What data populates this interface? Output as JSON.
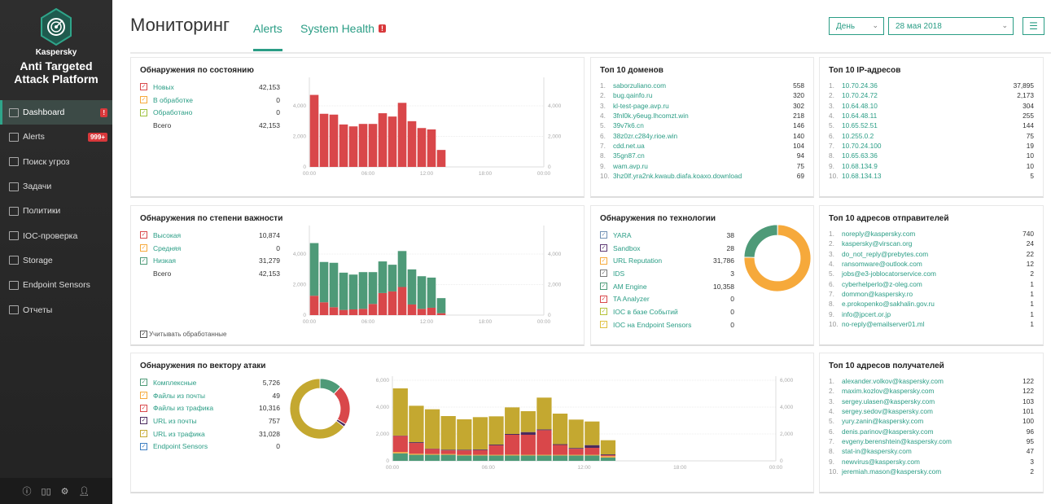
{
  "sidebar": {
    "brand_small": "Kaspersky",
    "brand_line1": "Anti Targeted",
    "brand_line2": "Attack Platform",
    "items": [
      {
        "label": "Dashboard",
        "badge": "!",
        "icon": "dashboard-icon"
      },
      {
        "label": "Alerts",
        "badge": "999+",
        "icon": "flag-icon"
      },
      {
        "label": "Поиск угроз",
        "icon": "threat-search-icon"
      },
      {
        "label": "Задачи",
        "icon": "tasks-icon"
      },
      {
        "label": "Политики",
        "icon": "policies-icon"
      },
      {
        "label": "IOC-проверка",
        "icon": "key-search-icon"
      },
      {
        "label": "Storage",
        "icon": "storage-icon"
      },
      {
        "label": "Endpoint Sensors",
        "icon": "monitor-icon"
      },
      {
        "label": "Отчеты",
        "icon": "report-icon"
      }
    ],
    "bottom_icons": [
      "info-icon",
      "book-icon",
      "gear-icon",
      "user-icon"
    ]
  },
  "header": {
    "title": "Мониторинг",
    "tabs": [
      {
        "label": "Alerts",
        "active": true
      },
      {
        "label": "System Health",
        "badge": "!"
      }
    ],
    "period": "День",
    "date": "28 мая 2018",
    "menu_icon": "hamburger-icon"
  },
  "colors": {
    "accent": "#2a9d85",
    "red": "#d9474a",
    "orange": "#f6a93b",
    "yellowgreen": "#9bbf3a",
    "green": "#4e9a78",
    "purple": "#4a2a5e",
    "olive": "#c4a830",
    "blue": "#3d7fc2"
  },
  "state": {
    "title": "Обнаружения по состоянию",
    "legend": [
      {
        "label": "Новых",
        "value": "42,153",
        "color": "#d9474a"
      },
      {
        "label": "В обработке",
        "value": "0",
        "color": "#f6a93b"
      },
      {
        "label": "Обработано",
        "value": "0",
        "color": "#9bbf3a"
      }
    ],
    "total_label": "Всего",
    "total": "42,153"
  },
  "severity": {
    "title": "Обнаружения по степени важности",
    "legend": [
      {
        "label": "Высокая",
        "value": "10,874",
        "color": "#d9474a"
      },
      {
        "label": "Средняя",
        "value": "0",
        "color": "#f6a93b"
      },
      {
        "label": "Низкая",
        "value": "31,279",
        "color": "#4e9a78"
      }
    ],
    "total_label": "Всего",
    "total": "42,153",
    "include_processed": "Учитывать обработанные"
  },
  "vector": {
    "title": "Обнаружения по вектору атаки",
    "legend": [
      {
        "label": "Комплексные",
        "value": "5,726",
        "color": "#4e9a78"
      },
      {
        "label": "Файлы из почты",
        "value": "49",
        "color": "#f6a93b"
      },
      {
        "label": "Файлы из трафика",
        "value": "10,316",
        "color": "#d9474a"
      },
      {
        "label": "URL из почты",
        "value": "757",
        "color": "#4a2a5e"
      },
      {
        "label": "URL из трафика",
        "value": "31,028",
        "color": "#c4a830"
      },
      {
        "label": "Endpoint Sensors",
        "value": "0",
        "color": "#3d7fc2"
      }
    ]
  },
  "technology": {
    "title": "Обнаружения по технологии",
    "legend": [
      {
        "label": "YARA",
        "value": "38",
        "color": "#6f8fb3"
      },
      {
        "label": "Sandbox",
        "value": "28",
        "color": "#5e3a74"
      },
      {
        "label": "URL Reputation",
        "value": "31,786",
        "color": "#f6a93b"
      },
      {
        "label": "IDS",
        "value": "3",
        "color": "#777777"
      },
      {
        "label": "AM Engine",
        "value": "10,358",
        "color": "#4e9a78"
      },
      {
        "label": "TA Analyzer",
        "value": "0",
        "color": "#d9474a"
      },
      {
        "label": "IOC в базе Событий",
        "value": "0",
        "color": "#b5c23a"
      },
      {
        "label": "IOC на Endpoint Sensors",
        "value": "0",
        "color": "#e0c040"
      }
    ]
  },
  "top_domains": {
    "title": "Топ 10 доменов",
    "items": [
      [
        "saborzuliano.com",
        "558"
      ],
      [
        "bug.qainfo.ru",
        "320"
      ],
      [
        "kl-test-page.avp.ru",
        "302"
      ],
      [
        "3fnl0k.y6eug.lhcomzt.win",
        "218"
      ],
      [
        "39v7k6.cn",
        "146"
      ],
      [
        "38z0zr.c284y.rioe.win",
        "140"
      ],
      [
        "cdd.net.ua",
        "104"
      ],
      [
        "35gn87.cn",
        "94"
      ],
      [
        "wam.avp.ru",
        "75"
      ],
      [
        "3hz0lf.yra2nk.kwaub.diafa.koaxo.download",
        "69"
      ]
    ]
  },
  "top_ips": {
    "title": "Топ 10 IP-адресов",
    "items": [
      [
        "10.70.24.36",
        "37,895"
      ],
      [
        "10.70.24.72",
        "2,173"
      ],
      [
        "10.64.48.10",
        "304"
      ],
      [
        "10.64.48.11",
        "255"
      ],
      [
        "10.65.52.51",
        "144"
      ],
      [
        "10.255.0.2",
        "75"
      ],
      [
        "10.70.24.100",
        "19"
      ],
      [
        "10.65.63.36",
        "10"
      ],
      [
        "10.68.134.9",
        "10"
      ],
      [
        "10.68.134.13",
        "5"
      ]
    ]
  },
  "top_senders": {
    "title": "Топ 10 адресов отправителей",
    "items": [
      [
        "noreply@kaspersky.com",
        "740"
      ],
      [
        "kaspersky@virscan.org",
        "24"
      ],
      [
        "do_not_reply@prebytes.com",
        "22"
      ],
      [
        "ransomware@outlook.com",
        "12"
      ],
      [
        "jobs@e3-joblocatorservice.com",
        "2"
      ],
      [
        "cyberhelperlo@z-oleg.com",
        "1"
      ],
      [
        "dommon@kaspersky.ro",
        "1"
      ],
      [
        "e.prokopenko@sakhalin.gov.ru",
        "1"
      ],
      [
        "info@jpcert.or.jp",
        "1"
      ],
      [
        "no-reply@emailserver01.ml",
        "1"
      ]
    ]
  },
  "top_recipients": {
    "title": "Топ 10 адресов получателей",
    "items": [
      [
        "alexander.volkov@kaspersky.com",
        "122"
      ],
      [
        "maxim.kozlov@kaspersky.com",
        "122"
      ],
      [
        "sergey.ulasen@kaspersky.com",
        "103"
      ],
      [
        "sergey.sedov@kaspersky.com",
        "101"
      ],
      [
        "yury.zanin@kaspersky.com",
        "100"
      ],
      [
        "denis.parinov@kaspersky.com",
        "96"
      ],
      [
        "evgeny.berenshtein@kaspersky.com",
        "95"
      ],
      [
        "stat-in@kaspersky.com",
        "47"
      ],
      [
        "newvirus@kaspersky.com",
        "3"
      ],
      [
        "jeremiah.mason@kaspersky.com",
        "2"
      ]
    ]
  },
  "chart_data": [
    {
      "id": "state",
      "type": "bar",
      "stacked": true,
      "x_ticks": [
        "00:00",
        "06:00",
        "12:00",
        "18:00",
        "00:00"
      ],
      "y_ticks": [
        "0",
        "2,000",
        "4,000"
      ],
      "ylim": [
        0,
        5600
      ],
      "hours": [
        0,
        1,
        2,
        3,
        4,
        5,
        6,
        7,
        8,
        9,
        10,
        11,
        12,
        13
      ],
      "series": [
        {
          "name": "Новых",
          "color": "#d9474a",
          "values": [
            4717,
            3480,
            3426,
            2780,
            2655,
            2816,
            2816,
            3516,
            3300,
            4197,
            2995,
            2547,
            2457,
            1112
          ]
        }
      ]
    },
    {
      "id": "severity",
      "type": "bar",
      "stacked": true,
      "x_ticks": [
        "00:00",
        "06:00",
        "12:00",
        "18:00",
        "00:00"
      ],
      "y_ticks": [
        "0",
        "2,000",
        "4,000"
      ],
      "ylim": [
        0,
        5600
      ],
      "hours": [
        0,
        1,
        2,
        3,
        4,
        5,
        6,
        7,
        8,
        9,
        10,
        11,
        12,
        13
      ],
      "series": [
        {
          "name": "Высокая",
          "color": "#d9474a",
          "values": [
            1268,
            840,
            518,
            340,
            375,
            410,
            732,
            1446,
            1553,
            1839,
            696,
            410,
            482,
            125
          ]
        },
        {
          "name": "Низкая",
          "color": "#4e9a78",
          "values": [
            3449,
            2640,
            2908,
            2440,
            2280,
            2406,
            2084,
            2070,
            1747,
            2358,
            2299,
            2137,
            1975,
            987
          ]
        }
      ]
    },
    {
      "id": "vector",
      "type": "bar",
      "stacked": true,
      "x_ticks": [
        "00:00",
        "06:00",
        "12:00",
        "18:00",
        "00:00"
      ],
      "y_ticks": [
        "0",
        "2,000",
        "4,000",
        "6,000"
      ],
      "ylim": [
        0,
        6000
      ],
      "hours": [
        0,
        1,
        2,
        3,
        4,
        5,
        6,
        7,
        8,
        9,
        10,
        11,
        12,
        13
      ],
      "series": [
        {
          "name": "Комплексные",
          "color": "#4e9a78",
          "values": [
            560,
            450,
            450,
            450,
            400,
            400,
            400,
            400,
            400,
            400,
            400,
            400,
            400,
            250
          ]
        },
        {
          "name": "Файлы из почты",
          "color": "#f6a93b",
          "values": [
            100,
            80,
            60,
            60,
            50,
            50,
            50,
            60,
            50,
            50,
            50,
            50,
            50,
            100
          ]
        },
        {
          "name": "Файлы из трафика",
          "color": "#d9474a",
          "values": [
            1200,
            800,
            380,
            270,
            330,
            350,
            700,
            1480,
            1490,
            1830,
            730,
            450,
            520,
            70
          ]
        },
        {
          "name": "URL из почты",
          "color": "#4a2a5e",
          "values": [
            20,
            60,
            20,
            50,
            50,
            50,
            60,
            60,
            200,
            60,
            60,
            60,
            200,
            60
          ]
        },
        {
          "name": "URL из трафика",
          "color": "#c4a830",
          "values": [
            3514,
            2710,
            2928,
            2503,
            2261,
            2403,
            2103,
            1980,
            1557,
            2367,
            2275,
            2111,
            1759,
            1055
          ]
        }
      ]
    },
    {
      "id": "vector-donut",
      "type": "pie",
      "donut": true,
      "values": [
        5726,
        49,
        10316,
        757,
        31028,
        0
      ],
      "colors": [
        "#4e9a78",
        "#f6a93b",
        "#d9474a",
        "#4a2a5e",
        "#c4a830",
        "#3d7fc2"
      ]
    },
    {
      "id": "tech-donut",
      "type": "pie",
      "donut": true,
      "values": [
        38,
        28,
        31786,
        3,
        10358,
        0,
        0,
        0
      ],
      "colors": [
        "#6f8fb3",
        "#5e3a74",
        "#f6a93b",
        "#777777",
        "#4e9a78",
        "#d9474a",
        "#b5c23a",
        "#e0c040"
      ]
    }
  ]
}
